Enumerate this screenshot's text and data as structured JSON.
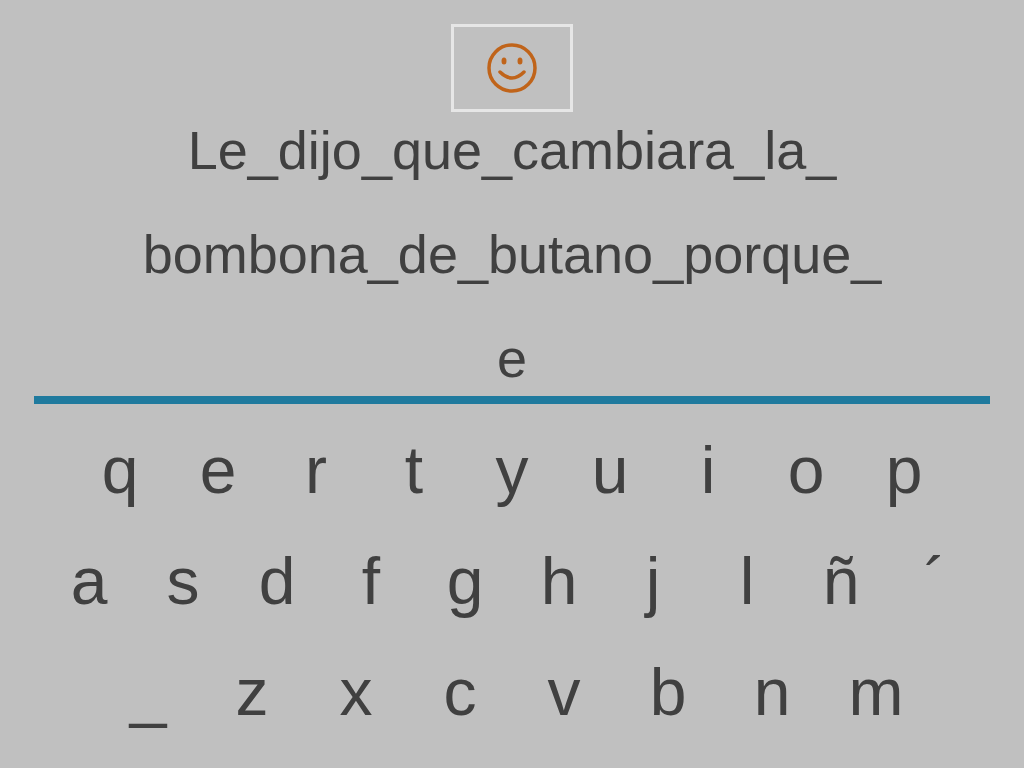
{
  "sentence_lines": [
    "Le_dijo_que_cambiara_la_",
    "bombona_de_butano_porque_",
    "e"
  ],
  "keyboard_rows": [
    [
      "q",
      "e",
      "r",
      "t",
      "y",
      "u",
      "i",
      "o",
      "p"
    ],
    [
      "a",
      "s",
      "d",
      "f",
      "g",
      "h",
      "j",
      "l",
      "ñ",
      "´"
    ],
    [
      "_",
      "z",
      "x",
      "c",
      "v",
      "b",
      "n",
      "m"
    ]
  ]
}
